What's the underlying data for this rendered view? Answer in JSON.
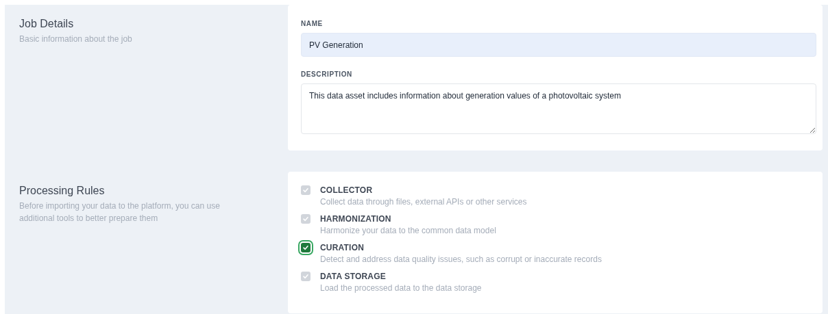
{
  "sections": [
    {
      "title": "Job Details",
      "subtitle": "Basic information about the job",
      "kind": "fields",
      "fields": [
        {
          "label": "NAME",
          "kind": "input",
          "value": "PV Generation"
        },
        {
          "label": "DESCRIPTION",
          "kind": "textarea",
          "value": "This data asset includes information about generation values of a photovoltaic system"
        }
      ]
    },
    {
      "title": "Processing Rules",
      "subtitle": "Before importing your data to the platform, you can use additional tools to better prepare them",
      "kind": "rules",
      "rules": [
        {
          "name": "COLLECTOR",
          "description": "Collect data through files, external APIs or other services",
          "checked": true,
          "disabled": true
        },
        {
          "name": "HARMONIZATION",
          "description": "Harmonize your data to the common data model",
          "checked": true,
          "disabled": true
        },
        {
          "name": "CURATION",
          "description": "Detect and address data quality issues, such as corrupt or inaccurate records",
          "checked": true,
          "disabled": false
        },
        {
          "name": "DATA STORAGE",
          "description": "Load the processed data to the data storage",
          "checked": true,
          "disabled": true
        }
      ]
    }
  ]
}
